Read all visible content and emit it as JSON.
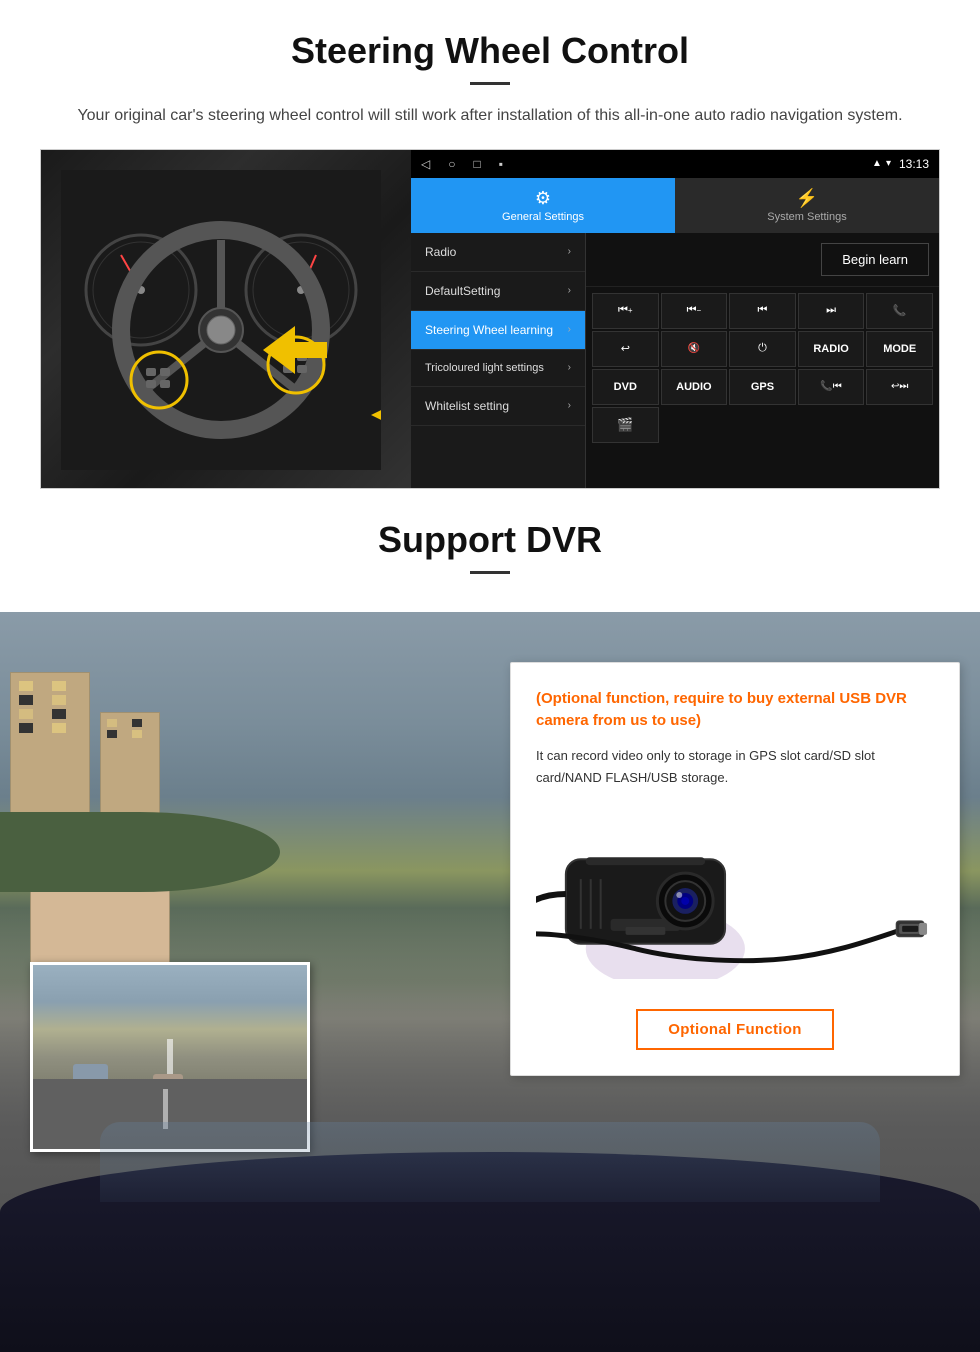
{
  "steering": {
    "title": "Steering Wheel Control",
    "subtitle": "Your original car's steering wheel control will still work after installation of this all-in-one auto radio navigation system.",
    "android": {
      "time": "13:13",
      "tab_general": "General Settings",
      "tab_system": "System Settings",
      "menu_radio": "Radio",
      "menu_default": "DefaultSetting",
      "menu_steering": "Steering Wheel learning",
      "menu_tricolour": "Tricoloured light settings",
      "menu_whitelist": "Whitelist setting",
      "begin_learn": "Begin learn",
      "controls": [
        "⏮+",
        "⏮−",
        "⏮⏮",
        "⏭⏭",
        "📞",
        "↩",
        "🔇",
        "⏻",
        "RADIO",
        "MODE",
        "DVD",
        "AUDIO",
        "GPS",
        "📞⏮",
        "↩⏭"
      ]
    }
  },
  "dvr": {
    "title": "Support DVR",
    "optional_heading": "(Optional function, require to buy external USB DVR camera from us to use)",
    "description": "It can record video only to storage in GPS slot card/SD slot card/NAND FLASH/USB storage.",
    "optional_button": "Optional Function"
  }
}
